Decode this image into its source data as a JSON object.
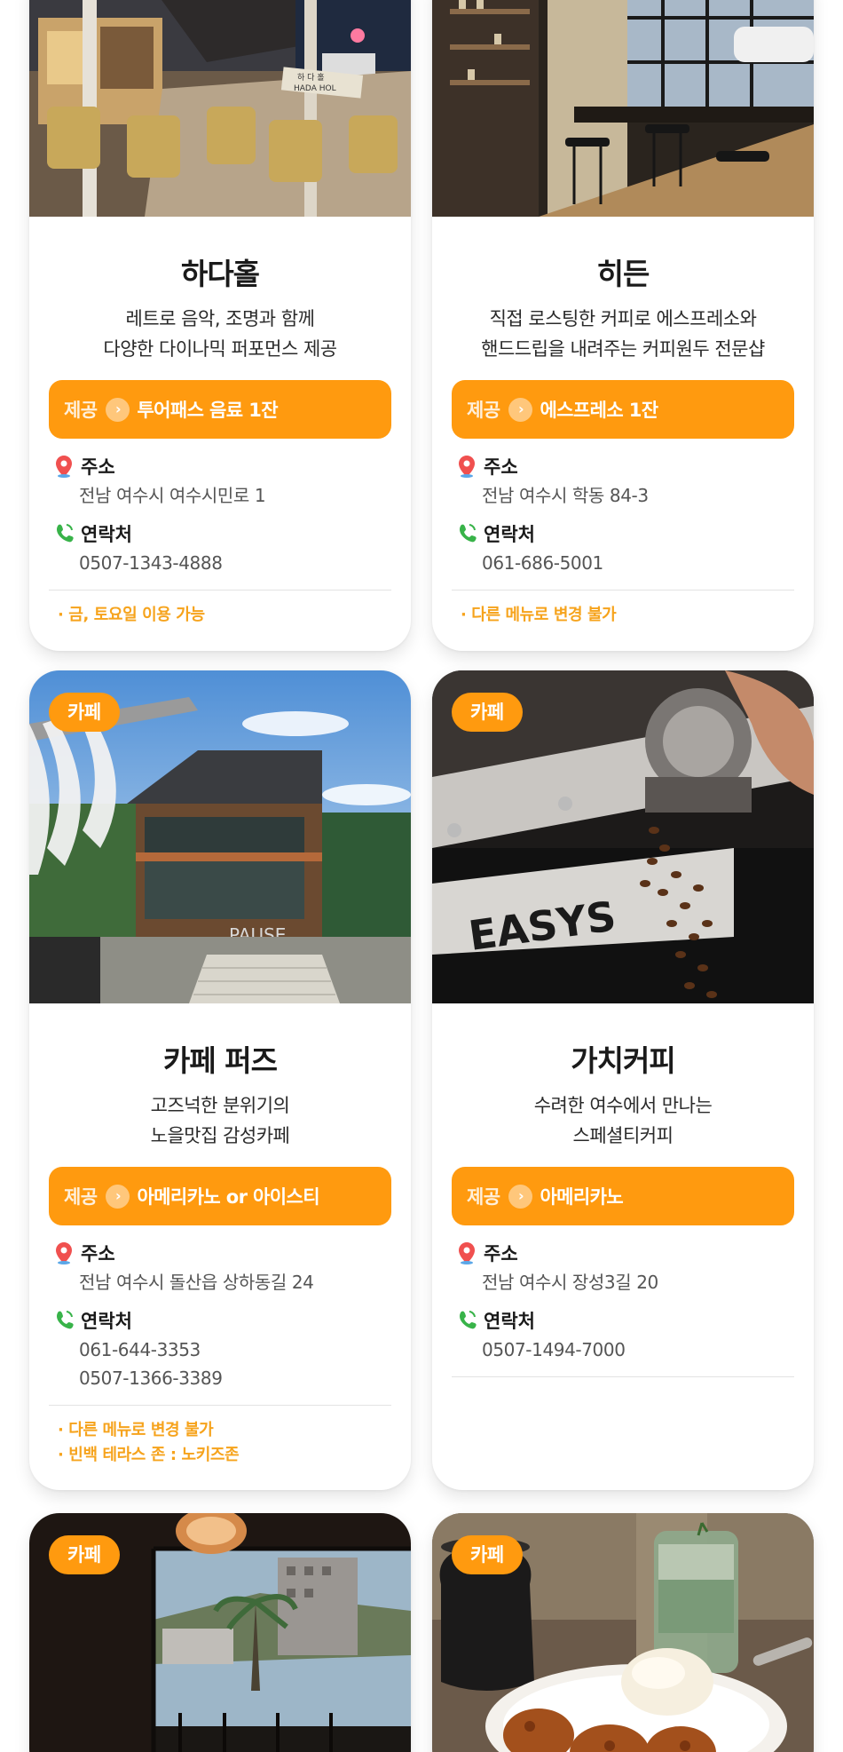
{
  "common": {
    "offer_prefix": "제공",
    "address_label": "주소",
    "contact_label": "연락처",
    "category": "카페"
  },
  "cards": [
    {
      "name": "하다홀",
      "desc": [
        "레트로 음악, 조명과 함께",
        "다양한 다이나믹 퍼포먼스 제공"
      ],
      "offer": "투어패스 음료 1잔",
      "address": "전남 여수시 여수시민로 1",
      "phones": [
        "0507-1343-4888"
      ],
      "notes": [
        "· 금, 토요일 이용 가능"
      ],
      "sign_text": [
        "하 다 홀",
        "HADA HOL"
      ]
    },
    {
      "name": "히든",
      "desc": [
        "직접 로스팅한 커피로 에스프레소와",
        "핸드드립을 내려주는 커피원두 전문샵"
      ],
      "offer": "에스프레소 1잔",
      "address": "전남 여수시 학동 84-3",
      "phones": [
        "061-686-5001"
      ],
      "notes": [
        "· 다른 메뉴로 변경 불가"
      ]
    },
    {
      "name": "카페 퍼즈",
      "desc": [
        "고즈넉한 분위기의",
        "노을맛집 감성카페"
      ],
      "offer": "아메리카노 or 아이스티",
      "address": "전남 여수시 돌산읍 상하동길 24",
      "phones": [
        "061-644-3353",
        "0507-1366-3389"
      ],
      "notes": [
        "· 다른 메뉴로 변경 불가",
        "· 빈백 테라스 존 : 노키즈존"
      ],
      "sign_text": "PAUSE"
    },
    {
      "name": "가치커피",
      "desc": [
        "수려한 여수에서 만나는",
        "스페셜티커피"
      ],
      "offer": "아메리카노",
      "address": "전남 여수시 장성3길 20",
      "phones": [
        "0507-1494-7000"
      ],
      "notes": [],
      "sign_text": "EASYS"
    },
    {
      "category": "카페"
    },
    {
      "category": "카페"
    }
  ]
}
